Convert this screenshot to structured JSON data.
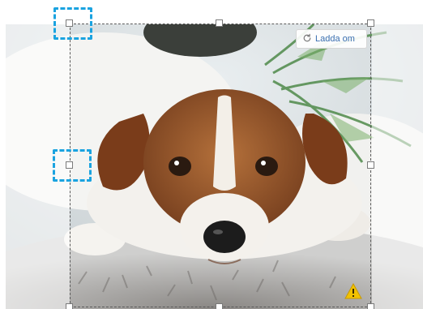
{
  "editor": {
    "reload_label": "Ladda om",
    "icons": {
      "reload": "refresh-icon",
      "warning": "warning-icon"
    },
    "colors": {
      "highlight": "#1aa3e0",
      "reload_text": "#3a6fb0",
      "warning": "#f2c200"
    }
  }
}
